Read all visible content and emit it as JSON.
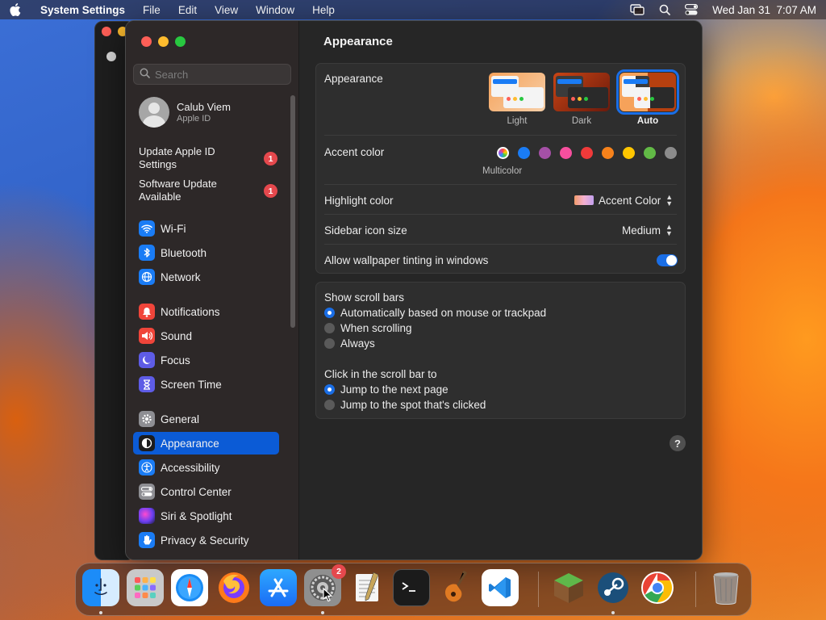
{
  "menubar": {
    "app_name": "System Settings",
    "menus": [
      "File",
      "Edit",
      "View",
      "Window",
      "Help"
    ],
    "datetime": "Wed Jan 31  7:07 AM"
  },
  "window": {
    "title": "Appearance"
  },
  "sidebar": {
    "search_placeholder": "Search",
    "profile": {
      "name": "Calub Viem",
      "subtitle": "Apple ID"
    },
    "alerts": [
      {
        "label_line1": "Update Apple ID",
        "label_line2": "Settings",
        "badge": "1"
      },
      {
        "label_line1": "Software Update",
        "label_line2": "Available",
        "badge": "1"
      }
    ],
    "items": [
      {
        "label": "Wi-Fi",
        "icon": "wifi-icon",
        "color": "#1a7cf5"
      },
      {
        "label": "Bluetooth",
        "icon": "bluetooth-icon",
        "color": "#1a7cf5"
      },
      {
        "label": "Network",
        "icon": "globe-icon",
        "color": "#1a7cf5"
      },
      {
        "label": "Notifications",
        "icon": "bell-icon",
        "color": "#f0453a"
      },
      {
        "label": "Sound",
        "icon": "speaker-icon",
        "color": "#f0453a"
      },
      {
        "label": "Focus",
        "icon": "moon-icon",
        "color": "#5e5ce6"
      },
      {
        "label": "Screen Time",
        "icon": "hourglass-icon",
        "color": "#5e5ce6"
      },
      {
        "label": "General",
        "icon": "gear-icon",
        "color": "#8e8e93"
      },
      {
        "label": "Appearance",
        "icon": "appearance-icon",
        "color": "#1c1c1e"
      },
      {
        "label": "Accessibility",
        "icon": "accessibility-icon",
        "color": "#1a7cf5"
      },
      {
        "label": "Control Center",
        "icon": "control-center-icon",
        "color": "#8e8e93"
      },
      {
        "label": "Siri & Spotlight",
        "icon": "siri-icon",
        "color": "#7d3fd6"
      },
      {
        "label": "Privacy & Security",
        "icon": "hand-icon",
        "color": "#1a7cf5"
      }
    ],
    "selected": "Appearance"
  },
  "appearance": {
    "section_label": "Appearance",
    "options": [
      {
        "label": "Light",
        "selected": false
      },
      {
        "label": "Dark",
        "selected": false
      },
      {
        "label": "Auto",
        "selected": true
      }
    ],
    "accent_label": "Accent color",
    "accent_colors": [
      "multicolor",
      "#1a7cf5",
      "#a550a7",
      "#f74f9e",
      "#f03a3a",
      "#f7821b",
      "#ffc600",
      "#62ba46",
      "#8c8c8c"
    ],
    "accent_selected": "Multicolor",
    "highlight_label": "Highlight color",
    "highlight_value": "Accent Color",
    "sidebar_icon_label": "Sidebar icon size",
    "sidebar_icon_value": "Medium",
    "tinting_label": "Allow wallpaper tinting in windows",
    "tinting_on": true
  },
  "scrollbars": {
    "show_label": "Show scroll bars",
    "show_options": [
      {
        "label": "Automatically based on mouse or trackpad",
        "selected": true
      },
      {
        "label": "When scrolling",
        "selected": false
      },
      {
        "label": "Always",
        "selected": false
      }
    ],
    "click_label": "Click in the scroll bar to",
    "click_options": [
      {
        "label": "Jump to the next page",
        "selected": true
      },
      {
        "label": "Jump to the spot that's clicked",
        "selected": false
      }
    ]
  },
  "help_label": "?",
  "dock": {
    "settings_badge": "2",
    "apps": [
      "Finder",
      "Launchpad",
      "Safari",
      "Firefox",
      "App Store",
      "System Settings",
      "TextEdit",
      "Terminal",
      "GarageBand",
      "Visual Studio Code",
      "Minecraft",
      "Steam",
      "Google Chrome",
      "Trash"
    ]
  }
}
